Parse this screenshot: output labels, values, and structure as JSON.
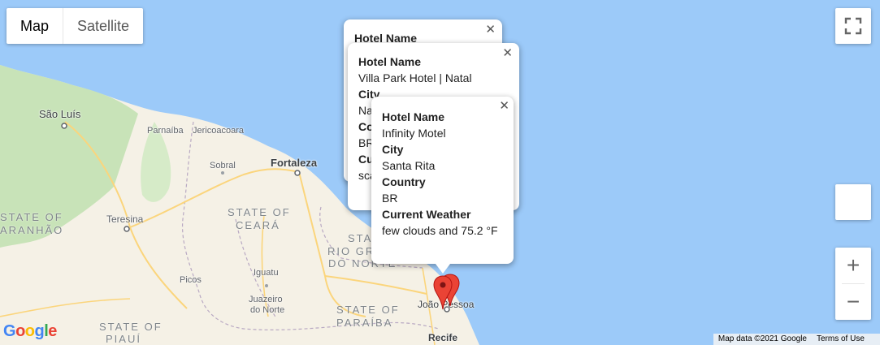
{
  "map_type": {
    "map_label": "Map",
    "satellite_label": "Satellite",
    "selected": "Map"
  },
  "colors": {
    "water": "#9ccaf9",
    "land": "#f5f1e6",
    "forest": "#c8e3b8",
    "road": "#fbd57c",
    "border": "#b9a9c3",
    "marker": "#ea4335"
  },
  "places": {
    "sao_luis": "São Luís",
    "parnaiba": "Parnaíba",
    "jericoacoara": "Jericoacoara",
    "sobral": "Sobral",
    "fortaleza": "Fortaleza",
    "teresina": "Teresina",
    "state_ceara_1": "STATE OF",
    "state_ceara_2": "CEARÁ",
    "state_maranhao_1": "STATE OF",
    "state_maranhao_2": "ARANHÃO",
    "state_rn_1": "STATE",
    "state_rn_2": "RIO GRA",
    "state_rn_3": "DO NORTE",
    "iguatu": "Iguatu",
    "picos": "Picos",
    "juazeiro_1": "Juazeiro",
    "juazeiro_2": "do Norte",
    "state_paraiba_1": "STATE OF",
    "state_paraiba_2": "PARAÍBA",
    "state_piaui_1": "STATE OF",
    "state_piaui_2": "PIAUÍ",
    "joao_pessoa": "João Pessoa",
    "recife": "Recife"
  },
  "popups": {
    "back": {
      "hotel_label": "Hotel Name"
    },
    "middle": {
      "hotel_label": "Hotel Name",
      "hotel_value": "Villa Park Hotel | Natal",
      "city_label": "City",
      "city_value": "Na",
      "country_label": "Co",
      "country_value": "BR",
      "weather_label": "Cu",
      "weather_value": "sca"
    },
    "front": {
      "hotel_label": "Hotel Name",
      "hotel_value": "Infinity Motel",
      "city_label": "City",
      "city_value": "Santa Rita",
      "country_label": "Country",
      "country_value": "BR",
      "weather_label": "Current Weather",
      "weather_value": "few clouds and 75.2 °F"
    }
  },
  "controls": {
    "fullscreen": "fullscreen-icon",
    "zoom_in": "+",
    "zoom_out": "−"
  },
  "footer": {
    "map_data": "Map data ©2021 Google",
    "terms": "Terms of Use",
    "logo": "Google"
  }
}
